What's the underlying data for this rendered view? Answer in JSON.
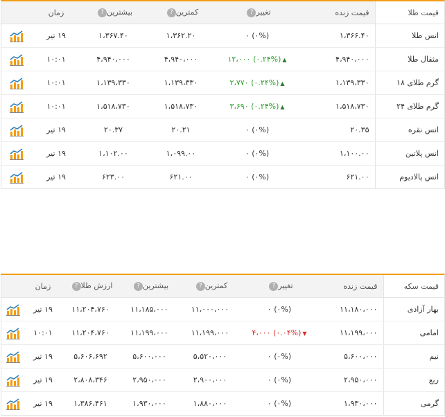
{
  "gold": {
    "headers": {
      "name": "قیمت طلا",
      "live": "قیمت زنده",
      "change": "تغییر",
      "low": "کمترین",
      "high": "بیشترین",
      "time": "زمان"
    },
    "rows": [
      {
        "name": "انس طلا",
        "live": "۱،۳۶۶.۴۰",
        "dir": "flat",
        "change": "(۰%) ۰",
        "low": "۱،۳۶۲.۲۰",
        "high": "۱،۳۶۷.۴۰",
        "time": "۱۹ تیر"
      },
      {
        "name": "مثقال طلا",
        "live": "۴،۹۴۰،۰۰۰",
        "dir": "up",
        "change": "(۰.۲۴%) ۱۲،۰۰۰",
        "low": "۴،۹۴۰،۰۰۰",
        "high": "۴،۹۴۰،۰۰۰",
        "time": "۱۰:۰۱"
      },
      {
        "name": "گرم طلای ۱۸",
        "live": "۱،۱۳۹،۳۳۰",
        "dir": "up",
        "change": "(۰.۲۴%) ۲،۷۷۰",
        "low": "۱،۱۳۹،۳۳۰",
        "high": "۱،۱۳۹،۳۳۰",
        "time": "۱۰:۰۱"
      },
      {
        "name": "گرم طلای ۲۴",
        "live": "۱،۵۱۸،۷۳۰",
        "dir": "up",
        "change": "(۰.۲۴%) ۳،۶۹۰",
        "low": "۱،۵۱۸،۷۳۰",
        "high": "۱،۵۱۸،۷۳۰",
        "time": "۱۰:۰۱"
      },
      {
        "name": "انس نقره",
        "live": "۲۰.۳۵",
        "dir": "flat",
        "change": "(۰%) ۰",
        "low": "۲۰.۲۱",
        "high": "۲۰.۳۷",
        "time": "۱۹ تیر"
      },
      {
        "name": "انس پلاتین",
        "live": "۱،۱۰۰.۰۰",
        "dir": "flat",
        "change": "(۰%) ۰",
        "low": "۱،۰۹۹.۰۰",
        "high": "۱،۱۰۲.۰۰",
        "time": "۱۹ تیر"
      },
      {
        "name": "انس پالادیوم",
        "live": "۶۲۱.۰۰",
        "dir": "flat",
        "change": "(۰%) ۰",
        "low": "۶۲۱.۰۰",
        "high": "۶۲۳.۰۰",
        "time": "۱۹ تیر"
      }
    ]
  },
  "coin": {
    "headers": {
      "name": "قیمت سکه",
      "live": "قیمت زنده",
      "change": "تغییر",
      "low": "کمترین",
      "high": "بیشترین",
      "value": "ارزش طلا",
      "time": "زمان"
    },
    "rows": [
      {
        "name": "بهار آزادی",
        "live": "۱۱،۱۸۰،۰۰۰",
        "dir": "flat",
        "change": "(۰%) ۰",
        "low": "۱۱،۰۰۰،۰۰۰",
        "high": "۱۱،۱۸۵،۰۰۰",
        "value": "۱۱،۲۰۴،۷۶۰",
        "time": "۱۹ تیر"
      },
      {
        "name": "امامی",
        "live": "۱۱،۱۹۹،۰۰۰",
        "dir": "down",
        "change": "(۰.۰۴%) ۴،۰۰۰",
        "low": "۱۱،۱۹۹،۰۰۰",
        "high": "۱۱،۱۹۹،۰۰۰",
        "value": "۱۱،۲۰۴،۷۶۰",
        "time": "۱۰:۰۱"
      },
      {
        "name": "نیم",
        "live": "۵،۶۰۰،۰۰۰",
        "dir": "flat",
        "change": "(۰%) ۰",
        "low": "۵،۵۲۰،۰۰۰",
        "high": "۵،۶۰۰،۰۰۰",
        "value": "۵،۶۰۶،۶۹۲",
        "time": "۱۹ تیر"
      },
      {
        "name": "ربع",
        "live": "۲،۹۵۰،۰۰۰",
        "dir": "flat",
        "change": "(۰%) ۰",
        "low": "۲،۹۰۰،۰۰۰",
        "high": "۲،۹۵۰،۰۰۰",
        "value": "۲،۸۰۸،۳۴۶",
        "time": "۱۹ تیر"
      },
      {
        "name": "گرمی",
        "live": "۱،۹۳۰،۰۰۰",
        "dir": "flat",
        "change": "(۰%) ۰",
        "low": "۱،۸۸۰،۰۰۰",
        "high": "۱،۹۳۰،۰۰۰",
        "value": "۱،۳۸۶،۴۶۱",
        "time": "۱۹ تیر"
      }
    ]
  },
  "icons": {
    "help": "question-circle-icon",
    "chart": "bar-chart-icon",
    "up": "triangle-up-icon",
    "down": "triangle-down-icon"
  },
  "colors": {
    "accent": "#f39c12",
    "up": "#2e9e2e",
    "down": "#d62b2b"
  }
}
